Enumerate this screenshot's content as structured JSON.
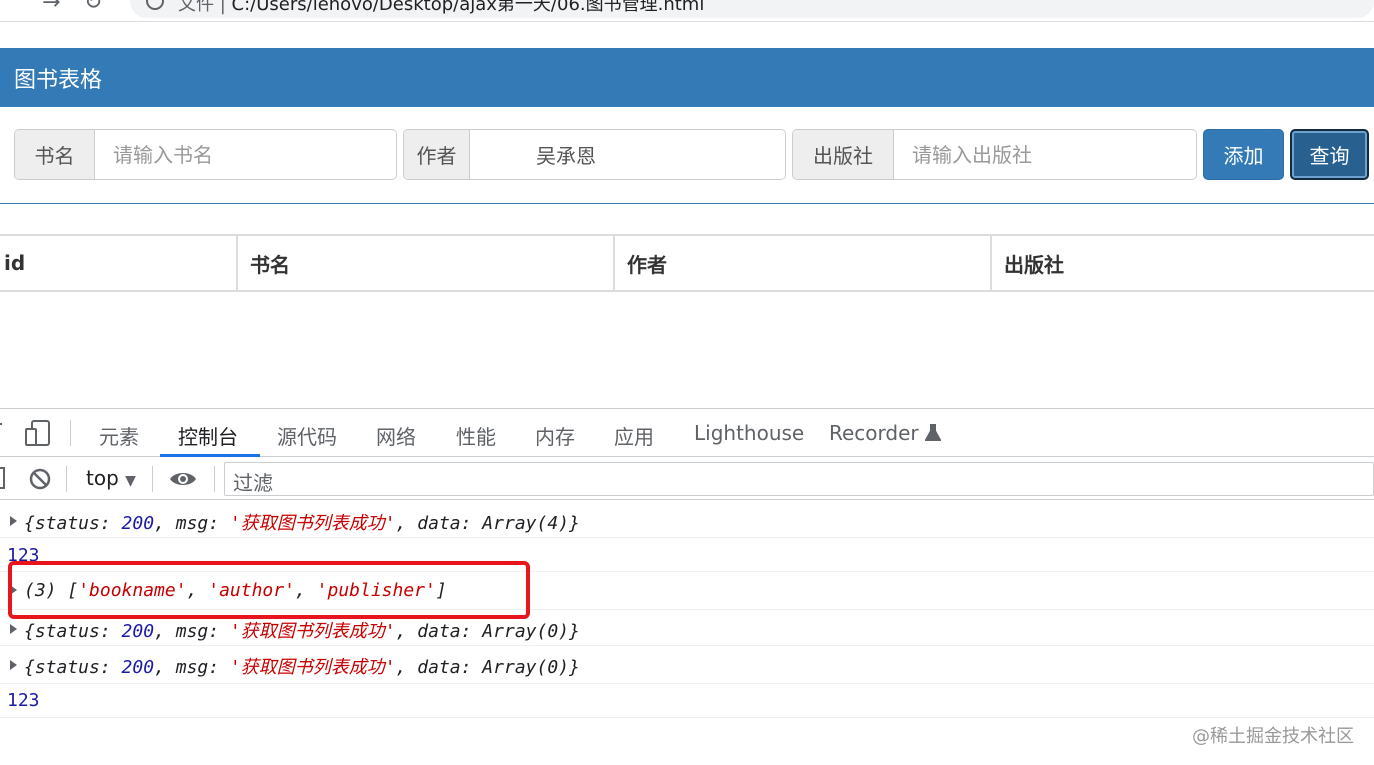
{
  "browser": {
    "url_prefix": "文件 |",
    "url_path": "C:/Users/lenovo/Desktop/ajax第一天/06.图书管理.html"
  },
  "panel": {
    "title": "图书表格"
  },
  "form": {
    "bookname_label": "书名",
    "bookname_placeholder": "请输入书名",
    "author_label": "作者",
    "author_value": "吴承恩",
    "publisher_label": "出版社",
    "publisher_placeholder": "请输入出版社",
    "add_button": "添加",
    "query_button": "查询"
  },
  "table": {
    "headers": [
      "id",
      "书名",
      "作者",
      "出版社"
    ]
  },
  "devtools": {
    "tabs": [
      "元素",
      "控制台",
      "源代码",
      "网络",
      "性能",
      "内存",
      "应用",
      "Lighthouse",
      "Recorder"
    ],
    "active_tab": "控制台",
    "context": "top",
    "filter_label": "过滤",
    "logs": [
      {
        "kind": "object",
        "parts": [
          "{status: ",
          "200",
          ", msg: ",
          "'获取图书列表成功'",
          ", data: Array(4)}"
        ]
      },
      {
        "kind": "number",
        "text": "123"
      },
      {
        "kind": "array",
        "parts": [
          "(3) [",
          "'bookname'",
          ", ",
          "'author'",
          ", ",
          "'publisher'",
          "]"
        ]
      },
      {
        "kind": "object",
        "parts": [
          "{status: ",
          "200",
          ", msg: ",
          "'获取图书列表成功'",
          ", data: Array(0)}"
        ]
      },
      {
        "kind": "object",
        "parts": [
          "{status: ",
          "200",
          ", msg: ",
          "'获取图书列表成功'",
          ", data: Array(0)}"
        ]
      },
      {
        "kind": "number",
        "text": "123"
      }
    ]
  },
  "watermark": "@稀土掘金技术社区",
  "colors": {
    "primary": "#337ab7",
    "highlight": "#e8141e",
    "string": "#c80000",
    "number": "#1a1aa6"
  }
}
